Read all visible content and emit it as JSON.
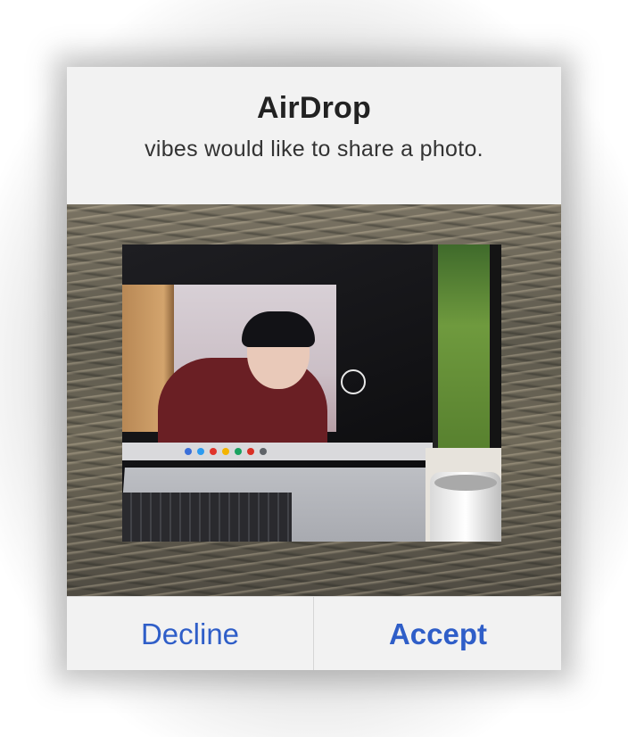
{
  "alert": {
    "title": "AirDrop",
    "message": "vibes would like to share a photo."
  },
  "buttons": {
    "decline_label": "Decline",
    "accept_label": "Accept"
  },
  "colors": {
    "button_text": "#2f5ec8",
    "alert_background": "#f2f2f2"
  }
}
